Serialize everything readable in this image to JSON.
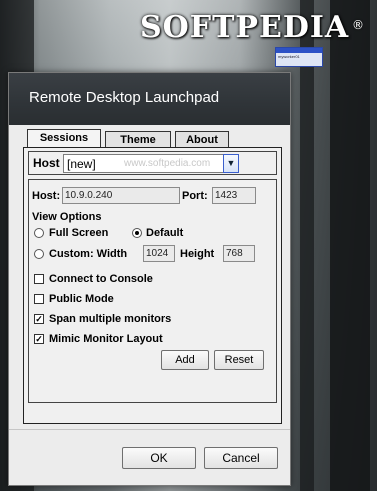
{
  "watermark": {
    "brand": "SOFTPEDIA",
    "registered": "®",
    "combo_watermark": "www.softpedia.com",
    "mini_window_label": "myworker01"
  },
  "window": {
    "title": "Remote Desktop Launchpad"
  },
  "tabs": [
    {
      "label": "Sessions",
      "active": true
    },
    {
      "label": "Theme",
      "active": false
    },
    {
      "label": "About",
      "active": false
    }
  ],
  "host": {
    "label": "Host",
    "value": "[new]"
  },
  "settings": {
    "host_label": "Host:",
    "host_value": "10.9.0.240",
    "port_label": "Port:",
    "port_value": "1423",
    "view_options_label": "View Options",
    "full_screen_label": "Full Screen",
    "default_label": "Default",
    "custom_width_label": "Custom: Width",
    "width_value": "1024",
    "height_label": "Height",
    "height_value": "768",
    "selected_view": "Default",
    "connect_console_label": "Connect to Console",
    "connect_console_checked": false,
    "public_mode_label": "Public Mode",
    "public_mode_checked": false,
    "span_monitors_label": "Span multiple monitors",
    "span_monitors_checked": true,
    "mimic_layout_label": "Mimic Monitor Layout",
    "mimic_layout_checked": true,
    "add_label": "Add",
    "reset_label": "Reset"
  },
  "footer": {
    "ok_label": "OK",
    "cancel_label": "Cancel"
  },
  "colors": {
    "titlebar": "#2f3438",
    "dialog": "#ececec",
    "combo_button": "#3a5fcd"
  }
}
